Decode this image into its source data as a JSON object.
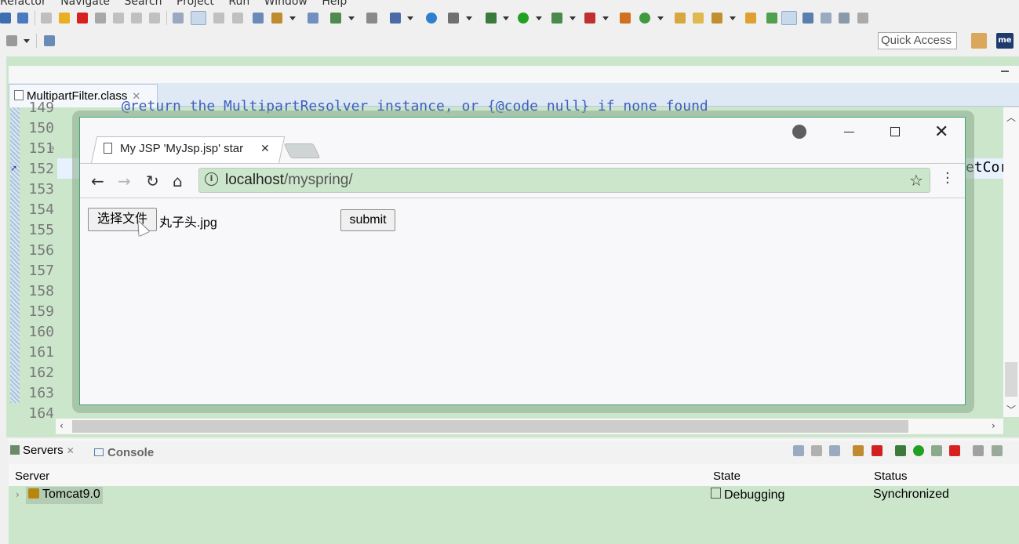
{
  "menubar": {
    "items": [
      "Refactor",
      "Navigate",
      "Search",
      "Project",
      "Run",
      "Window",
      "Help"
    ]
  },
  "toolbar": {
    "quick_access_label": "Quick Access",
    "me_badge": "me"
  },
  "editor": {
    "tab_title": "MultipartFilter.class",
    "line_numbers": [
      "149",
      "150",
      "151",
      "152",
      "153",
      "154",
      "155",
      "156",
      "157",
      "158",
      "159",
      "160",
      "161",
      "162",
      "163",
      "164"
    ],
    "top_code_line": "@return the MultipartResolver instance, or {@code null} if none found",
    "right_code_fragment": "etCor"
  },
  "browser": {
    "tab_title": "My JSP 'MyJsp.jsp' star",
    "url_host": "localhost",
    "url_path": "/myspring/",
    "page": {
      "file_button_label": "选择文件",
      "file_name": "丸子头.jpg",
      "submit_label": "submit"
    }
  },
  "servers_view": {
    "tabs": [
      {
        "label": "Servers",
        "icon": "servers-icon"
      },
      {
        "label": "Console",
        "icon": "console-icon"
      }
    ],
    "columns": [
      "Server",
      "State",
      "Status"
    ],
    "rows": [
      {
        "server": "Tomcat9.0",
        "state": "Debugging",
        "status": "Synchronized"
      }
    ]
  },
  "colors": {
    "editor_bg": "#cce6cc",
    "browser_border": "#3aa876",
    "url_bar": "#cce6cc",
    "current_line": "#e8f2fe"
  }
}
